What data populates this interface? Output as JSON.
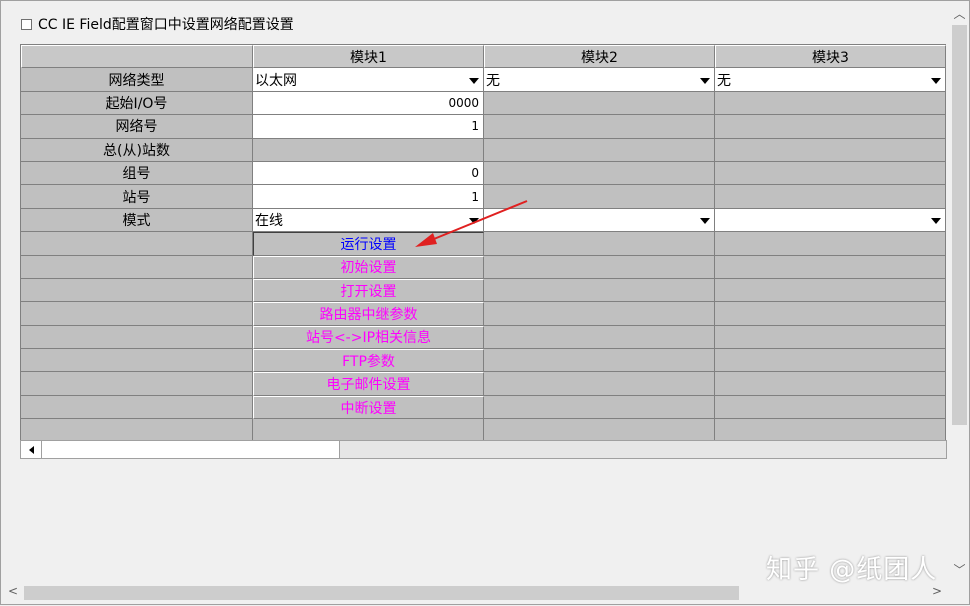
{
  "checkbox": {
    "label": "CC IE Field配置窗口中设置网络配置设置",
    "checked": false
  },
  "columns": [
    "",
    "模块1",
    "模块2",
    "模块3"
  ],
  "rows": {
    "network_type": {
      "label": "网络类型",
      "m1": "以太网",
      "m2": "无",
      "m3": "无"
    },
    "start_io": {
      "label": "起始I/O号",
      "m1": "0000"
    },
    "network_no": {
      "label": "网络号",
      "m1": "1"
    },
    "total_stations": {
      "label": "总(从)站数"
    },
    "group_no": {
      "label": "组号",
      "m1": "0"
    },
    "station_no": {
      "label": "站号",
      "m1": "1"
    },
    "mode": {
      "label": "模式",
      "m1": "在线"
    }
  },
  "buttons": [
    "运行设置",
    "初始设置",
    "打开设置",
    "路由器中继参数",
    "站号<->IP相关信息",
    "FTP参数",
    "电子邮件设置",
    "中断设置"
  ],
  "watermark": "知乎 @纸团人",
  "colors": {
    "grid_gray": "#c0c0c0",
    "button_magenta": "#ff00ff",
    "button_blue": "#0000ff",
    "arrow_red": "#e02020"
  }
}
